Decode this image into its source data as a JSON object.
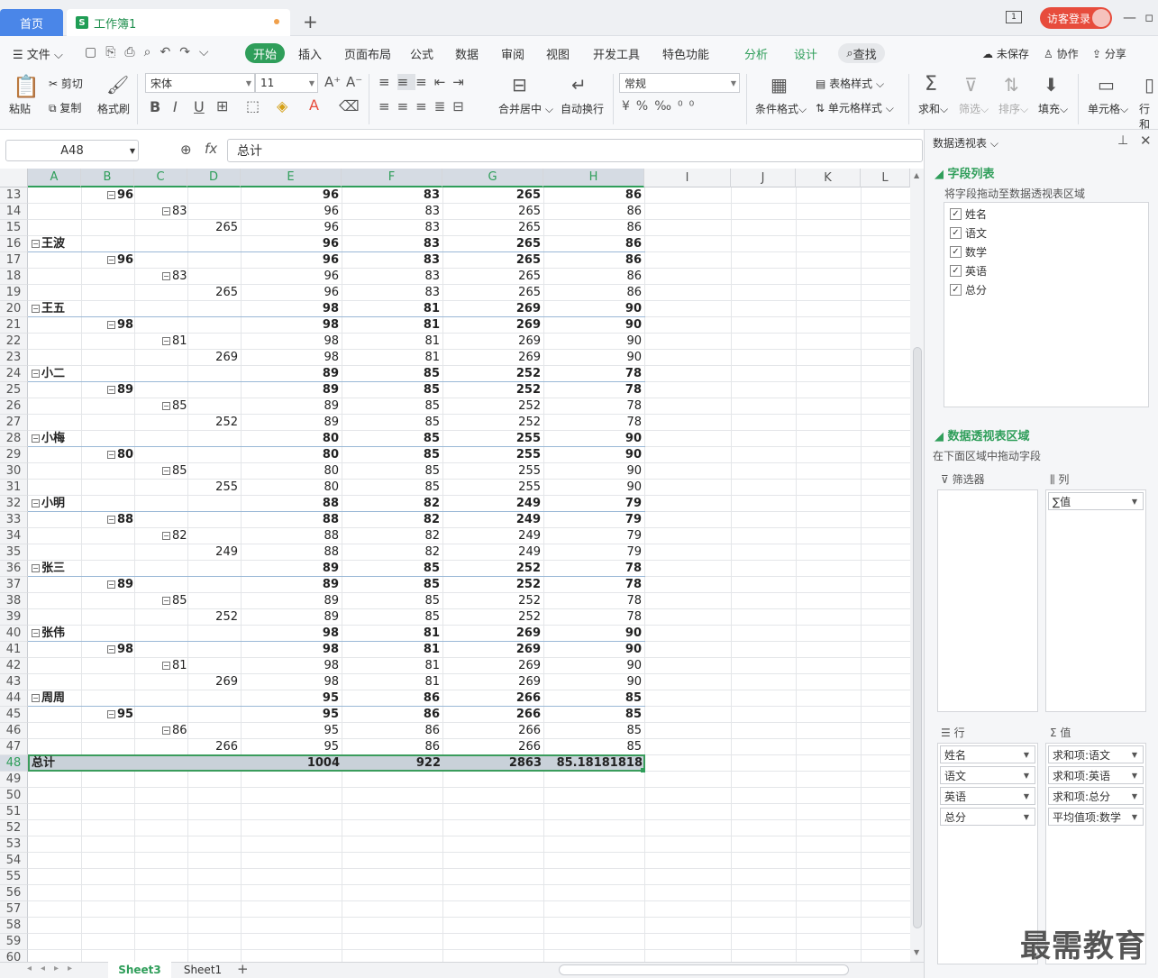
{
  "titlebar": {
    "home_tab": "首页",
    "workbook_tab": "工作簿1",
    "workbook_icon": "S",
    "new_tab": "+",
    "login": "访客登录",
    "page_indicator": "1"
  },
  "menu": {
    "file": "文件",
    "start": "开始",
    "items": [
      "插入",
      "页面布局",
      "公式",
      "数据",
      "审阅",
      "视图",
      "开发工具",
      "特色功能"
    ],
    "context_tabs": [
      "分析",
      "设计"
    ],
    "search": "查找",
    "unsaved": "未保存",
    "collab": "协作",
    "share": "分享"
  },
  "ribbon": {
    "paste": "粘贴",
    "cut": "剪切",
    "copy": "复制",
    "format_painter": "格式刷",
    "font_name": "宋体",
    "font_size": "11",
    "merge_center": "合并居中",
    "wrap_text": "自动换行",
    "number_format": "常规",
    "conditional_format": "条件格式",
    "table_style": "表格样式",
    "cell_style": "单元格样式",
    "sum": "求和",
    "filter": "筛选",
    "sort": "排序",
    "fill": "填充",
    "cells": "单元格",
    "rows_cols": "行和"
  },
  "formula_bar": {
    "name_box": "A48",
    "fx": "fx",
    "value": "总计"
  },
  "columns": [
    "A",
    "B",
    "C",
    "D",
    "E",
    "F",
    "G",
    "H",
    "I",
    "J",
    "K",
    "L"
  ],
  "rows": [
    13,
    14,
    15,
    16,
    17,
    18,
    19,
    20,
    21,
    22,
    23,
    24,
    25,
    26,
    27,
    28,
    29,
    30,
    31,
    32,
    33,
    34,
    35,
    36,
    37,
    38,
    39,
    40,
    41,
    42,
    43,
    44,
    45,
    46,
    47,
    48,
    49,
    50,
    51,
    52,
    53,
    54,
    55,
    56,
    57,
    58,
    59,
    60
  ],
  "pivot": {
    "records": [
      {
        "name": null,
        "yuwen": "96",
        "yingyu": "83",
        "zongfen": "265",
        "E": "96",
        "F": "83",
        "G": "265",
        "H": "86"
      },
      {
        "name": "王波",
        "yuwen": "96",
        "yingyu": "83",
        "zongfen": "265",
        "E": "96",
        "F": "83",
        "G": "265",
        "H": "86"
      },
      {
        "name": "王五",
        "yuwen": "98",
        "yingyu": "81",
        "zongfen": "269",
        "E": "98",
        "F": "81",
        "G": "269",
        "H": "90"
      },
      {
        "name": "小二",
        "yuwen": "89",
        "yingyu": "85",
        "zongfen": "252",
        "E": "89",
        "F": "85",
        "G": "252",
        "H": "78"
      },
      {
        "name": "小梅",
        "yuwen": "80",
        "yingyu": "85",
        "zongfen": "255",
        "E": "80",
        "F": "85",
        "G": "255",
        "H": "90"
      },
      {
        "name": "小明",
        "yuwen": "88",
        "yingyu": "82",
        "zongfen": "249",
        "E": "88",
        "F": "82",
        "G": "249",
        "H": "79"
      },
      {
        "name": "张三",
        "yuwen": "89",
        "yingyu": "85",
        "zongfen": "252",
        "E": "89",
        "F": "85",
        "G": "252",
        "H": "78"
      },
      {
        "name": "张伟",
        "yuwen": "98",
        "yingyu": "81",
        "zongfen": "269",
        "E": "98",
        "F": "81",
        "G": "269",
        "H": "90"
      },
      {
        "name": "周周",
        "yuwen": "95",
        "yingyu": "86",
        "zongfen": "266",
        "E": "95",
        "F": "86",
        "G": "266",
        "H": "85"
      }
    ],
    "total": {
      "label": "总计",
      "E": "1004",
      "F": "922",
      "G": "2863",
      "H": "85.18181818"
    }
  },
  "sheets": {
    "active": "Sheet3",
    "other": "Sheet1",
    "add": "+"
  },
  "panel": {
    "title": "数据透视表",
    "field_list_title": "字段列表",
    "field_list_hint": "将字段拖动至数据透视表区域",
    "fields": [
      "姓名",
      "语文",
      "数学",
      "英语",
      "总分"
    ],
    "area_title": "数据透视表区域",
    "area_hint": "在下面区域中拖动字段",
    "filter_label": "筛选器",
    "column_label": "列",
    "row_label": "行",
    "value_label": "值",
    "column_items": [
      "∑值"
    ],
    "row_items": [
      "姓名",
      "语文",
      "英语",
      "总分"
    ],
    "value_items": [
      "求和项:语文",
      "求和项:英语",
      "求和项:总分",
      "平均值项:数学"
    ]
  },
  "watermark": "最需教育",
  "colors": {
    "accent": "#2f9e5a",
    "home_tab": "#4a86e8",
    "login": "#e74c3c"
  }
}
